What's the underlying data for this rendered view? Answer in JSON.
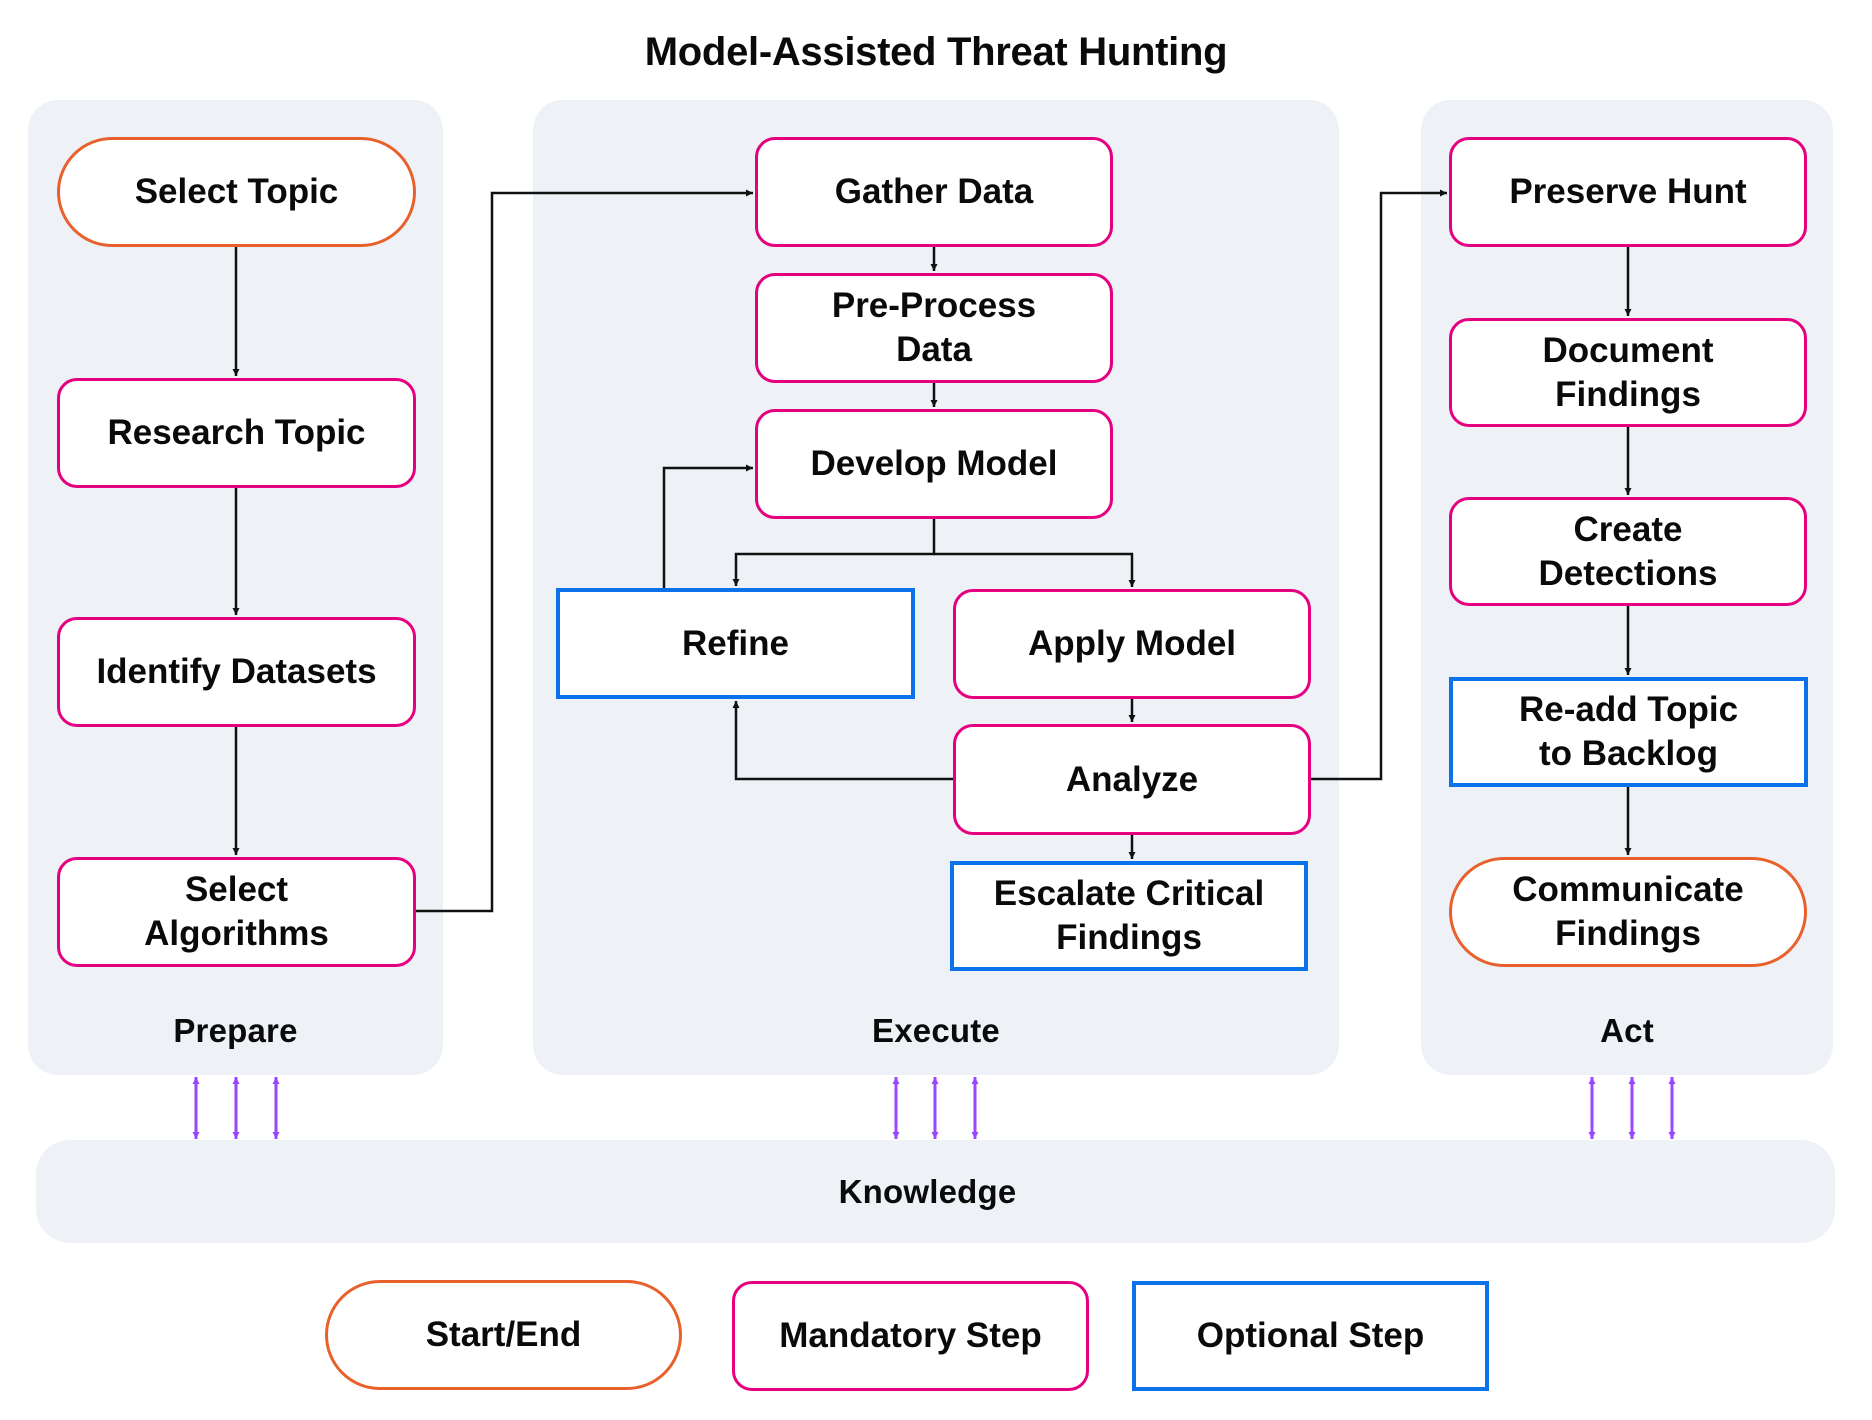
{
  "title": "Model-Assisted Threat Hunting",
  "colors": {
    "start_end": "#e8612c",
    "mandatory": "#e5007f",
    "optional": "#0b72ea",
    "knowledge_arrows": "#9747ff",
    "panel_background": "#eef2f7",
    "connector": "#111111"
  },
  "phases": [
    {
      "label": "Prepare",
      "steps": [
        {
          "id": "select-topic",
          "lines": [
            "Select Topic"
          ],
          "type": "start_end"
        },
        {
          "id": "research-topic",
          "lines": [
            "Research Topic"
          ],
          "type": "mandatory"
        },
        {
          "id": "identify-datasets",
          "lines": [
            "Identify Datasets"
          ],
          "type": "mandatory"
        },
        {
          "id": "select-algorithms",
          "lines": [
            "Select",
            "Algorithms"
          ],
          "type": "mandatory"
        }
      ]
    },
    {
      "label": "Execute",
      "steps": [
        {
          "id": "gather-data",
          "lines": [
            "Gather Data"
          ],
          "type": "mandatory"
        },
        {
          "id": "pre-process-data",
          "lines": [
            "Pre-Process",
            "Data"
          ],
          "type": "mandatory"
        },
        {
          "id": "develop-model",
          "lines": [
            "Develop Model"
          ],
          "type": "mandatory"
        },
        {
          "id": "refine",
          "lines": [
            "Refine"
          ],
          "type": "optional"
        },
        {
          "id": "apply-model",
          "lines": [
            "Apply Model"
          ],
          "type": "mandatory"
        },
        {
          "id": "analyze",
          "lines": [
            "Analyze"
          ],
          "type": "mandatory"
        },
        {
          "id": "escalate-critical-findings",
          "lines": [
            "Escalate Critical",
            "Findings"
          ],
          "type": "optional"
        }
      ]
    },
    {
      "label": "Act",
      "steps": [
        {
          "id": "preserve-hunt",
          "lines": [
            "Preserve Hunt"
          ],
          "type": "mandatory"
        },
        {
          "id": "document-findings",
          "lines": [
            "Document",
            "Findings"
          ],
          "type": "mandatory"
        },
        {
          "id": "create-detections",
          "lines": [
            "Create",
            "Detections"
          ],
          "type": "mandatory"
        },
        {
          "id": "re-add-topic",
          "lines": [
            "Re-add Topic",
            "to Backlog"
          ],
          "type": "optional"
        },
        {
          "id": "communicate-findings",
          "lines": [
            "Communicate",
            "Findings"
          ],
          "type": "start_end"
        }
      ]
    }
  ],
  "knowledge": {
    "label": "Knowledge"
  },
  "edges": [
    {
      "from": "select-topic",
      "to": "research-topic"
    },
    {
      "from": "research-topic",
      "to": "identify-datasets"
    },
    {
      "from": "identify-datasets",
      "to": "select-algorithms"
    },
    {
      "from": "select-algorithms",
      "to": "gather-data"
    },
    {
      "from": "gather-data",
      "to": "pre-process-data"
    },
    {
      "from": "pre-process-data",
      "to": "develop-model"
    },
    {
      "from": "develop-model",
      "to": "refine"
    },
    {
      "from": "develop-model",
      "to": "apply-model"
    },
    {
      "from": "refine",
      "to": "develop-model"
    },
    {
      "from": "apply-model",
      "to": "analyze"
    },
    {
      "from": "analyze",
      "to": "refine"
    },
    {
      "from": "analyze",
      "to": "escalate-critical-findings"
    },
    {
      "from": "analyze",
      "to": "preserve-hunt"
    },
    {
      "from": "preserve-hunt",
      "to": "document-findings"
    },
    {
      "from": "document-findings",
      "to": "create-detections"
    },
    {
      "from": "create-detections",
      "to": "re-add-topic"
    },
    {
      "from": "re-add-topic",
      "to": "communicate-findings"
    },
    {
      "from": "Prepare",
      "to": "Knowledge",
      "bidirectional": true,
      "count": 3
    },
    {
      "from": "Execute",
      "to": "Knowledge",
      "bidirectional": true,
      "count": 3
    },
    {
      "from": "Act",
      "to": "Knowledge",
      "bidirectional": true,
      "count": 3
    }
  ],
  "legend": [
    {
      "label": "Start/End",
      "type": "start_end"
    },
    {
      "label": "Mandatory Step",
      "type": "mandatory"
    },
    {
      "label": "Optional Step",
      "type": "optional"
    }
  ]
}
